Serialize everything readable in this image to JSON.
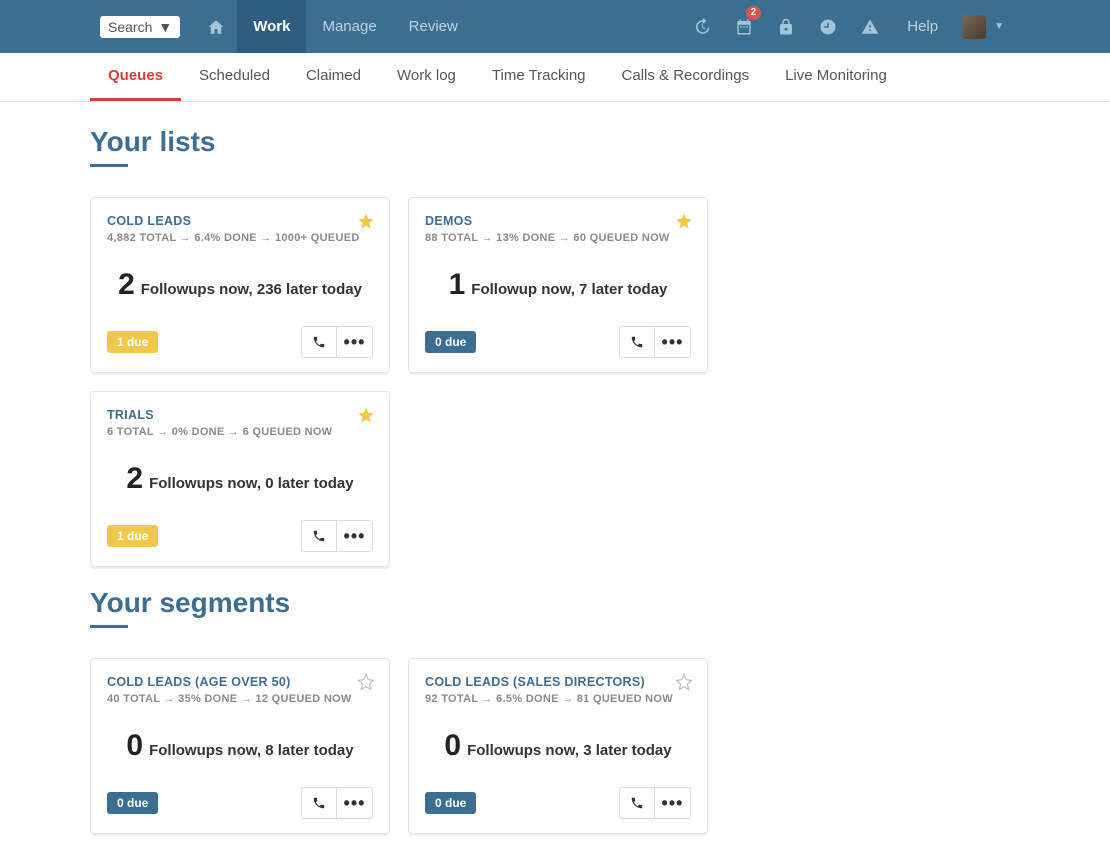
{
  "topnav": {
    "search_label": "Search",
    "items": [
      {
        "label": "Work",
        "active": true
      },
      {
        "label": "Manage",
        "active": false
      },
      {
        "label": "Review",
        "active": false
      }
    ],
    "badge_count": "2",
    "help_label": "Help"
  },
  "subnav": {
    "items": [
      {
        "label": "Queues",
        "active": true
      },
      {
        "label": "Scheduled",
        "active": false
      },
      {
        "label": "Claimed",
        "active": false
      },
      {
        "label": "Work log",
        "active": false
      },
      {
        "label": "Time Tracking",
        "active": false
      },
      {
        "label": "Calls & Recordings",
        "active": false
      },
      {
        "label": "Live Monitoring",
        "active": false
      }
    ]
  },
  "sections": {
    "lists": {
      "title": "Your lists",
      "cards": [
        {
          "title": "COLD LEADS",
          "stats": "4,882 TOTAL → 6.4% DONE → 1000+ QUEUED",
          "big": "2",
          "follow_text": "Followups now, 236 later today",
          "due_label": "1 due",
          "due_style": "yellow",
          "starred": true
        },
        {
          "title": "DEMOS",
          "stats": "88 TOTAL → 13% DONE → 60 QUEUED NOW",
          "big": "1",
          "follow_text": "Followup now, 7 later today",
          "due_label": "0 due",
          "due_style": "blue",
          "starred": true
        },
        {
          "title": "TRIALS",
          "stats": "6 TOTAL → 0% DONE → 6 QUEUED NOW",
          "big": "2",
          "follow_text": "Followups now, 0 later today",
          "due_label": "1 due",
          "due_style": "yellow",
          "starred": true
        }
      ]
    },
    "segments": {
      "title": "Your segments",
      "cards": [
        {
          "title": "COLD LEADS (AGE OVER 50)",
          "stats": "40 TOTAL → 35% DONE → 12 QUEUED NOW",
          "big": "0",
          "follow_text": "Followups now, 8 later today",
          "due_label": "0 due",
          "due_style": "blue",
          "starred": false
        },
        {
          "title": "COLD LEADS (SALES DIRECTORS)",
          "stats": "92 TOTAL → 6.5% DONE → 81 QUEUED NOW",
          "big": "0",
          "follow_text": "Followups now, 3 later today",
          "due_label": "0 due",
          "due_style": "blue",
          "starred": false
        }
      ]
    }
  }
}
